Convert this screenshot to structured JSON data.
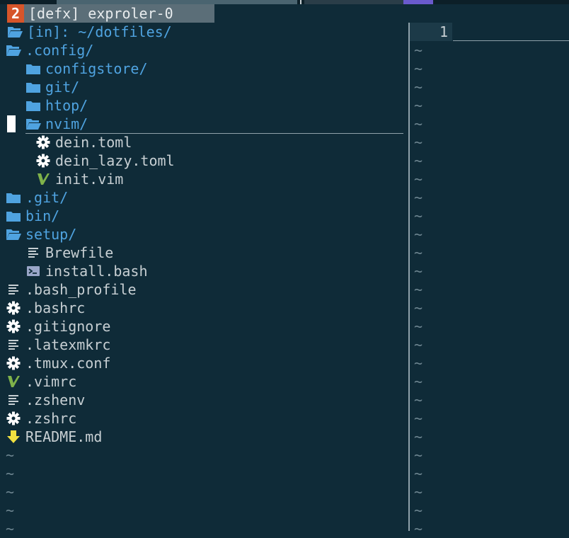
{
  "window": {
    "buffer_number": "2",
    "buffer_name": "[defx] exproler-0"
  },
  "tree": {
    "header": "[in]: ~/dotfiles/",
    "items": [
      {
        "label": ".config/",
        "icon": "folder-open-icon",
        "kind": "dir",
        "depth": 0
      },
      {
        "label": "configstore/",
        "icon": "folder-icon",
        "kind": "dir",
        "depth": 1
      },
      {
        "label": "git/",
        "icon": "folder-icon",
        "kind": "dir",
        "depth": 1
      },
      {
        "label": "htop/",
        "icon": "folder-icon",
        "kind": "dir",
        "depth": 1
      },
      {
        "label": "nvim/",
        "icon": "folder-open-icon",
        "kind": "dir",
        "depth": 1,
        "cursor": true
      },
      {
        "label": "dein.toml",
        "icon": "gear-icon",
        "kind": "file",
        "depth": 2
      },
      {
        "label": "dein_lazy.toml",
        "icon": "gear-icon",
        "kind": "file",
        "depth": 2
      },
      {
        "label": "init.vim",
        "icon": "vim-icon",
        "kind": "file",
        "depth": 2
      },
      {
        "label": ".git/",
        "icon": "folder-icon",
        "kind": "dir",
        "depth": 0
      },
      {
        "label": "bin/",
        "icon": "folder-icon",
        "kind": "dir",
        "depth": 0
      },
      {
        "label": "setup/",
        "icon": "folder-open-icon",
        "kind": "dir",
        "depth": 0
      },
      {
        "label": "Brewfile",
        "icon": "text-file-icon",
        "kind": "file",
        "depth": 1
      },
      {
        "label": "install.bash",
        "icon": "terminal-icon",
        "kind": "file",
        "depth": 1
      },
      {
        "label": ".bash_profile",
        "icon": "text-file-icon",
        "kind": "file",
        "depth": 0
      },
      {
        "label": ".bashrc",
        "icon": "gear-icon",
        "kind": "file",
        "depth": 0
      },
      {
        "label": ".gitignore",
        "icon": "gear-icon",
        "kind": "file",
        "depth": 0
      },
      {
        "label": ".latexmkrc",
        "icon": "text-file-icon",
        "kind": "file",
        "depth": 0
      },
      {
        "label": ".tmux.conf",
        "icon": "gear-icon",
        "kind": "file",
        "depth": 0
      },
      {
        "label": ".vimrc",
        "icon": "vim-icon",
        "kind": "file",
        "depth": 0
      },
      {
        "label": ".zshenv",
        "icon": "text-file-icon",
        "kind": "file",
        "depth": 0
      },
      {
        "label": ".zshrc",
        "icon": "gear-icon",
        "kind": "file",
        "depth": 0
      },
      {
        "label": "README.md",
        "icon": "download-arrow-icon",
        "kind": "file",
        "depth": 0
      }
    ],
    "filler": "~"
  },
  "editor": {
    "line_number": "1",
    "filler": "~"
  },
  "colors": {
    "background": "#0f2b38",
    "dir": "#4fa3e0",
    "file": "#c7cfd3",
    "gear": "#ffffff",
    "vim": "#7fb24a",
    "readme": "#f0e040",
    "terminal": "#9aa6c8"
  }
}
